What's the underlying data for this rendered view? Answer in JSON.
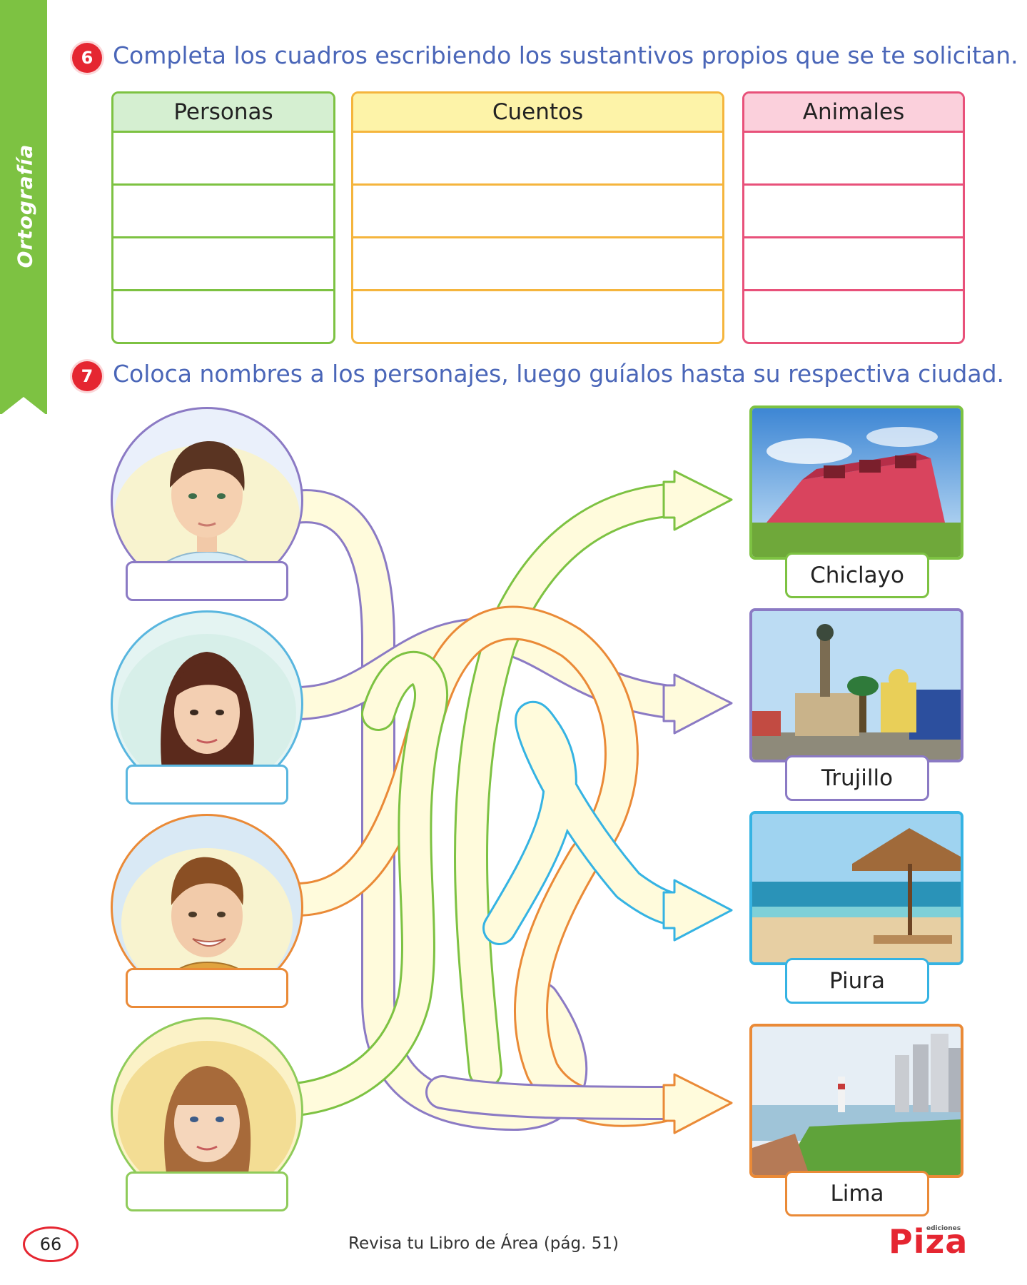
{
  "side_tab": {
    "label": "Ortografía"
  },
  "exercise6": {
    "number": "6",
    "instruction": "Completa los cuadros escribiendo los sustantivos propios que se te solicitan.",
    "tables": [
      {
        "header": "Personas",
        "color": "#7dc242",
        "fill": "#d5efd1"
      },
      {
        "header": "Cuentos",
        "color": "#f5b53d",
        "fill": "#fdf3a8"
      },
      {
        "header": "Animales",
        "color": "#e8517a",
        "fill": "#fbd0dc"
      }
    ]
  },
  "exercise7": {
    "number": "7",
    "instruction": "Coloca nombres a los personajes, luego guíalos hasta su respectiva ciudad.",
    "characters": [
      {
        "name": "boy-dark-hair",
        "color": "#8b7ac4"
      },
      {
        "name": "girl-long-hair",
        "color": "#59b6df"
      },
      {
        "name": "boy-smiling",
        "color": "#ea8a37"
      },
      {
        "name": "girl-bangs",
        "color": "#8fcb5a"
      }
    ],
    "cities": [
      {
        "label": "Chiclayo",
        "color": "#7dc242"
      },
      {
        "label": "Trujillo",
        "color": "#8b7ac4"
      },
      {
        "label": "Piura",
        "color": "#35b3e3"
      },
      {
        "label": "Lima",
        "color": "#ea8a37"
      }
    ]
  },
  "footer": {
    "page_number": "66",
    "reference": "Revisa tu Libro de Área (pág. 51)",
    "logo_top": "ediciones",
    "logo": "Piza"
  }
}
